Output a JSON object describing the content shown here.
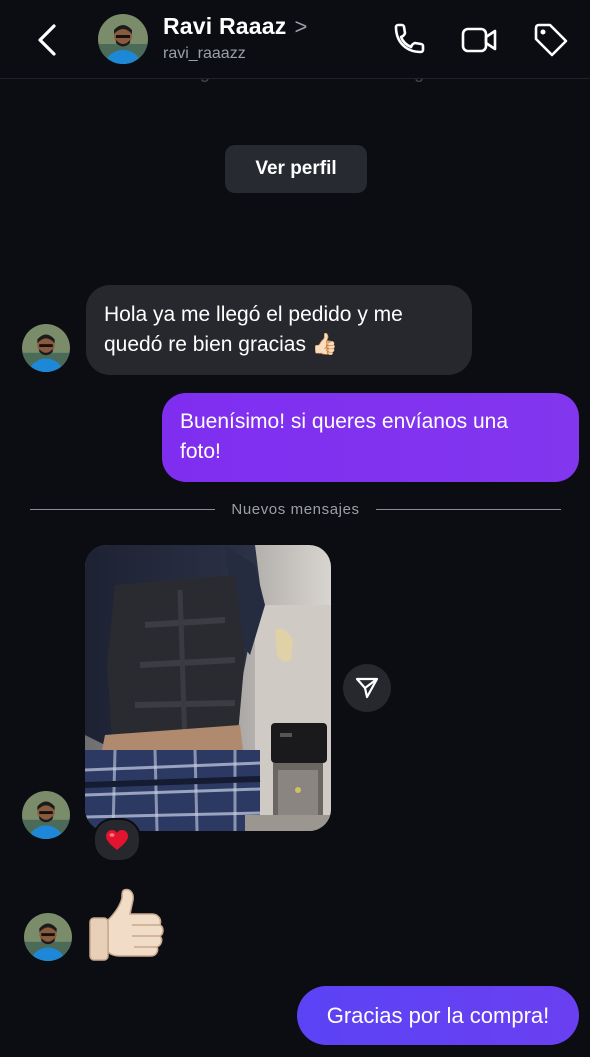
{
  "header": {
    "name": "Ravi Raaaz",
    "name_chevron": ">",
    "username": "ravi_raaazz"
  },
  "notice": {
    "partial_text": "No se siguen mutuamente en Instagram"
  },
  "profile_button_label": "Ver perfil",
  "messages": [
    {
      "direction": "incoming",
      "text_line1": "Hola ya me llegó el pedido y me",
      "text_line2": "quedó re bien gracias 👍🏻"
    },
    {
      "direction": "outgoing",
      "text_line1": "Buenísimo! si queres envíanos una",
      "text_line2": "foto!"
    },
    {
      "direction": "incoming",
      "type": "photo",
      "reaction": "❤️"
    },
    {
      "direction": "incoming",
      "type": "emoji",
      "emoji": "👍🏻"
    },
    {
      "direction": "outgoing",
      "text": "Gracias por la compra!"
    }
  ],
  "divider_label": "Nuevos mensajes",
  "icons": {
    "back": "chevron-left-icon",
    "call": "phone-icon",
    "video": "video-camera-icon",
    "tag": "tag-icon",
    "share": "send-icon"
  },
  "colors": {
    "background": "#0b0d12",
    "incoming_bubble": "#26282e",
    "outgoing_bubble": "#7f2ef0",
    "outgoing_bubble_2": "#5b43f5"
  }
}
